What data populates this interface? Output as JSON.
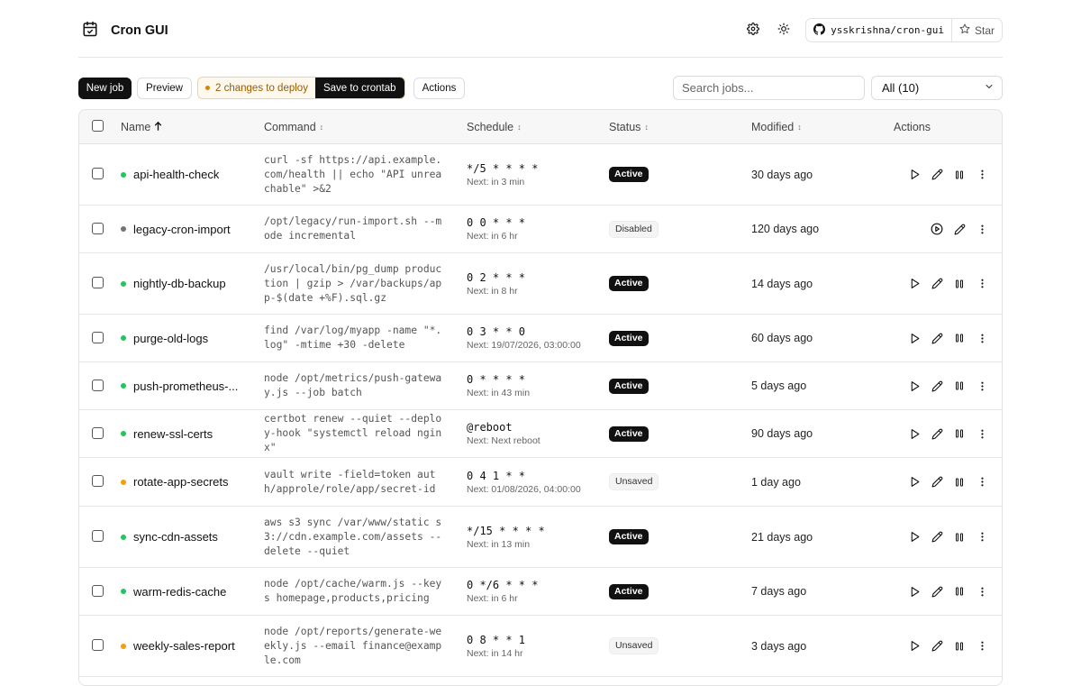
{
  "app": {
    "title": "Cron GUI"
  },
  "header": {
    "repo": "ysskrishna/cron-gui",
    "star_label": "Star"
  },
  "toolbar": {
    "new_job": "New job",
    "preview": "Preview",
    "changes": "2 changes to deploy",
    "save": "Save to crontab",
    "actions": "Actions",
    "search_placeholder": "Search jobs...",
    "filter_value": "All (10)"
  },
  "columns": {
    "name": "Name",
    "command": "Command",
    "schedule": "Schedule",
    "status": "Status",
    "modified": "Modified",
    "actions": "Actions"
  },
  "colors": {
    "active": "#22c55e",
    "disabled": "#737373",
    "unsaved": "#f59e0b"
  },
  "jobs": [
    {
      "name": "api-health-check",
      "dot": "active",
      "command": "curl -sf https://api.example.com/health || echo \"API unreachable\" >&2",
      "schedule": "*/5 * * * *",
      "next": "Next: in 3 min",
      "status": "Active",
      "modified": "30 days ago"
    },
    {
      "name": "legacy-cron-import",
      "dot": "disabled",
      "command": "/opt/legacy/run-import.sh --mode incremental",
      "schedule": "0 0 * * *",
      "next": "Next: in 6 hr",
      "status": "Disabled",
      "modified": "120 days ago"
    },
    {
      "name": "nightly-db-backup",
      "dot": "active",
      "command": "/usr/local/bin/pg_dump production | gzip > /var/backups/app-$(date +%F).sql.gz",
      "schedule": "0 2 * * *",
      "next": "Next: in 8 hr",
      "status": "Active",
      "modified": "14 days ago"
    },
    {
      "name": "purge-old-logs",
      "dot": "active",
      "command": "find /var/log/myapp -name \"*.log\" -mtime +30 -delete",
      "schedule": "0 3 * * 0",
      "next": "Next: 19/07/2026, 03:00:00",
      "status": "Active",
      "modified": "60 days ago"
    },
    {
      "name": "push-prometheus-...",
      "dot": "active",
      "command": "node /opt/metrics/push-gateway.js --job batch",
      "schedule": "0 * * * *",
      "next": "Next: in 43 min",
      "status": "Active",
      "modified": "5 days ago"
    },
    {
      "name": "renew-ssl-certs",
      "dot": "active",
      "command": "certbot renew --quiet --deploy-hook \"systemctl reload nginx\"",
      "schedule": "@reboot",
      "next": "Next: Next reboot",
      "status": "Active",
      "modified": "90 days ago"
    },
    {
      "name": "rotate-app-secrets",
      "dot": "unsaved",
      "command": "vault write -field=token auth/approle/role/app/secret-id",
      "schedule": "0 4 1 * *",
      "next": "Next: 01/08/2026, 04:00:00",
      "status": "Unsaved",
      "modified": "1 day ago"
    },
    {
      "name": "sync-cdn-assets",
      "dot": "active",
      "command": "aws s3 sync /var/www/static s3://cdn.example.com/assets --delete --quiet",
      "schedule": "*/15 * * * *",
      "next": "Next: in 13 min",
      "status": "Active",
      "modified": "21 days ago"
    },
    {
      "name": "warm-redis-cache",
      "dot": "active",
      "command": "node /opt/cache/warm.js --keys homepage,products,pricing",
      "schedule": "0 */6 * * *",
      "next": "Next: in 6 hr",
      "status": "Active",
      "modified": "7 days ago"
    },
    {
      "name": "weekly-sales-report",
      "dot": "unsaved",
      "command": "node /opt/reports/generate-weekly.js --email finance@example.com",
      "schedule": "0 8 * * 1",
      "next": "Next: in 14 hr",
      "status": "Unsaved",
      "modified": "3 days ago"
    }
  ]
}
